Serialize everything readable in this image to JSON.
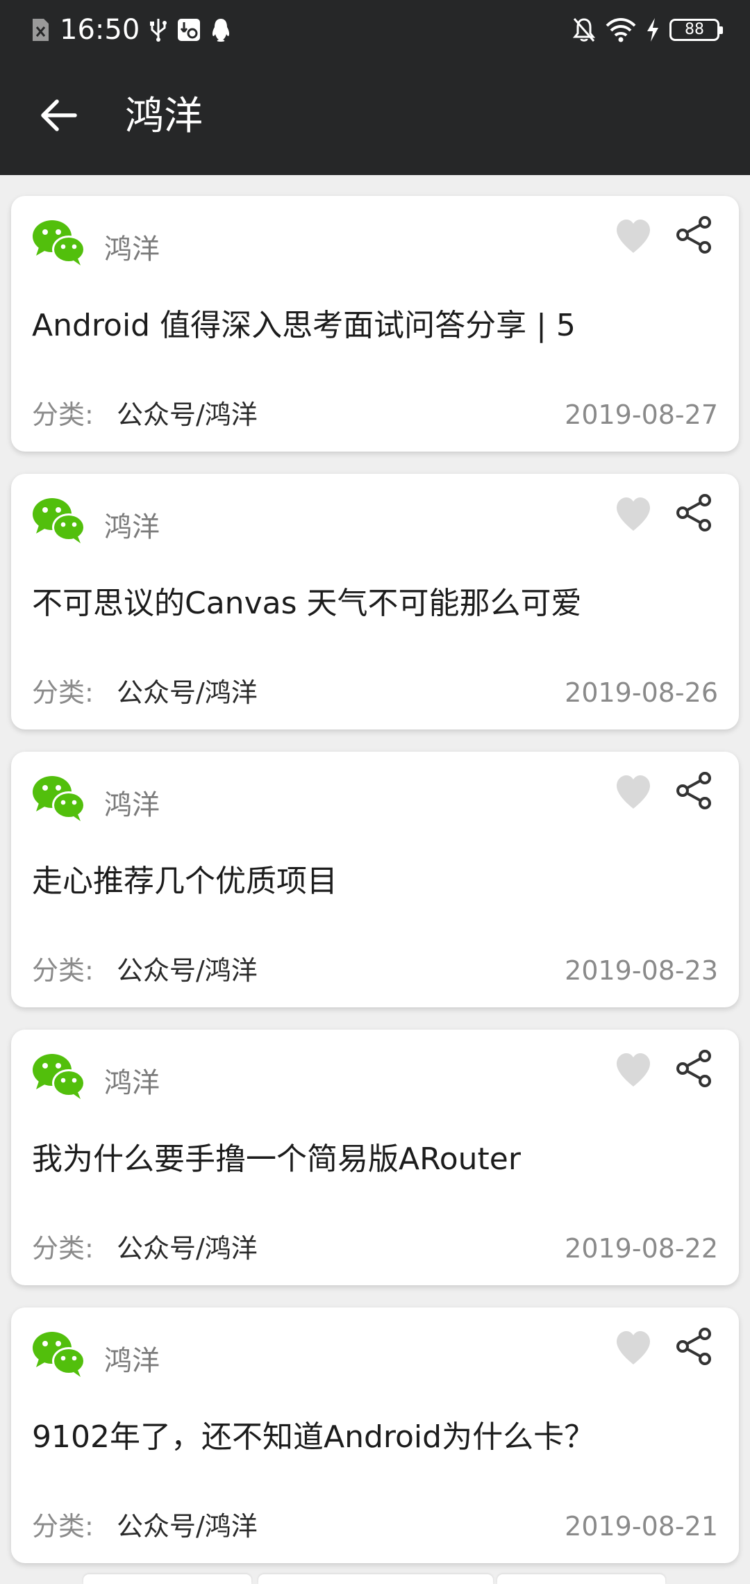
{
  "status_bar": {
    "time": "16:50",
    "battery": "88",
    "left_icons": [
      "sim-off-icon",
      "usb-icon",
      "usb-debug-icon",
      "qq-icon"
    ],
    "right_icons": [
      "mute-icon",
      "wifi-icon",
      "charging-icon",
      "battery-icon"
    ]
  },
  "toolbar": {
    "title": "鸿洋",
    "back_icon": "arrow-left-icon"
  },
  "colors": {
    "header_bg": "#262728",
    "page_bg": "#efefef",
    "wechat_green": "#52bf0c",
    "like_gray": "#d9d9d9"
  },
  "articles": [
    {
      "author": "鸿洋",
      "title": "Android 值得深入思考面试问答分享 | 5",
      "category_label": "分类:",
      "category": "公众号/鸿洋",
      "date": "2019-08-27"
    },
    {
      "author": "鸿洋",
      "title": "不可思议的Canvas 天气不可能那么可爱",
      "category_label": "分类:",
      "category": "公众号/鸿洋",
      "date": "2019-08-26"
    },
    {
      "author": "鸿洋",
      "title": "走心推荐几个优质项目",
      "category_label": "分类:",
      "category": "公众号/鸿洋",
      "date": "2019-08-23"
    },
    {
      "author": "鸿洋",
      "title": "我为什么要手撸一个简易版ARouter",
      "category_label": "分类:",
      "category": "公众号/鸿洋",
      "date": "2019-08-22"
    },
    {
      "author": "鸿洋",
      "title": "9102年了，还不知道Android为什么卡？",
      "category_label": "分类:",
      "category": "公众号/鸿洋",
      "date": "2019-08-21"
    }
  ]
}
